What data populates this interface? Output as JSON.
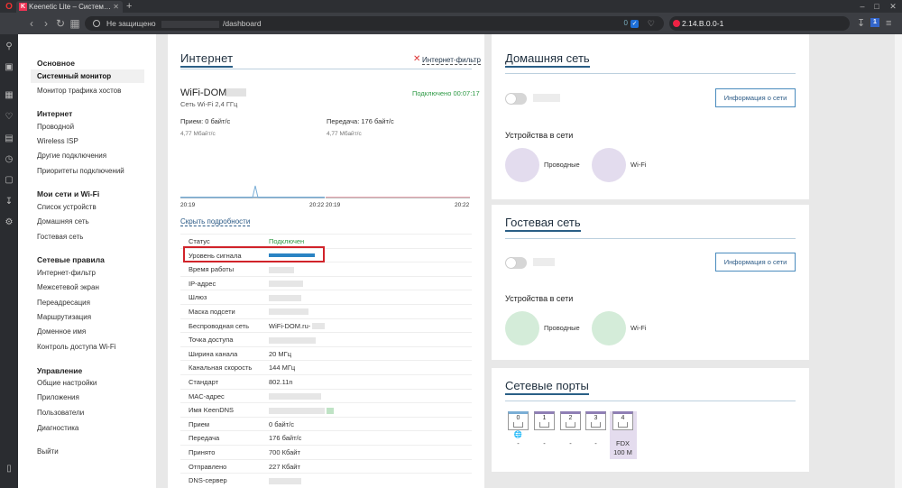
{
  "browser": {
    "tab_title": "Keenetic Lite – Систем…",
    "tab_logo": "K",
    "close_glyph": "✕",
    "new_tab_glyph": "+",
    "security_text": "Не защищено",
    "url_path": "/dashboard",
    "ext_text": "2.14.B.0.0-1",
    "adblock_count": "0"
  },
  "sidebar": {
    "groups": [
      {
        "title": "Основное",
        "items": [
          "Системный монитор",
          "Монитор трафика хостов"
        ]
      },
      {
        "title": "Интернет",
        "items": [
          "Проводной",
          "Wireless ISP",
          "Другие подключения",
          "Приоритеты подключений"
        ]
      },
      {
        "title": "Мои сети и Wi-Fi",
        "items": [
          "Список устройств",
          "Домашняя сеть",
          "Гостевая сеть"
        ]
      },
      {
        "title": "Сетевые правила",
        "items": [
          "Интернет-фильтр",
          "Межсетевой экран",
          "Переадресация",
          "Маршрутизация",
          "Доменное имя",
          "Контроль доступа Wi-Fi"
        ]
      },
      {
        "title": "Управление",
        "items": [
          "Общие настройки",
          "Приложения",
          "Пользователи",
          "Диагностика"
        ]
      }
    ],
    "logout": "Выйти"
  },
  "internet": {
    "title": "Интернет",
    "filter_link": "Интернет-фильтр",
    "wifi_name": "WiFi-DOM.ru-",
    "wifi_sub": "Сеть Wi-Fi 2,4 ГГц",
    "connected": "Подключено 00:07:17",
    "rx_label": "Прием: 0 байт/с",
    "tx_label": "Передача: 176 байт/с",
    "rx_rate": "4,77 Мбайт/с",
    "tx_rate": "4,77 Мбайт/с",
    "time_start": "20:19",
    "time_end": "20:22",
    "hide_details": "Скрыть подробности",
    "rows": [
      {
        "k": "Статус",
        "v": "Подключен",
        "green": true
      },
      {
        "k": "Уровень сигнала",
        "v": ""
      },
      {
        "k": "Время работы",
        "v": ""
      },
      {
        "k": "IP-адрес",
        "v": ""
      },
      {
        "k": "Шлюз",
        "v": ""
      },
      {
        "k": "Маска подсети",
        "v": ""
      },
      {
        "k": "Беспроводная сеть",
        "v": "WiFi-DOM.ru-"
      },
      {
        "k": "Точка доступа",
        "v": ""
      },
      {
        "k": "Ширина канала",
        "v": "20 МГц"
      },
      {
        "k": "Канальная скорость",
        "v": "144 МГц"
      },
      {
        "k": "Стандарт",
        "v": "802.11n"
      },
      {
        "k": "MAC-адрес",
        "v": ""
      },
      {
        "k": "Имя KeenDNS",
        "v": ""
      },
      {
        "k": "Прием",
        "v": "0 байт/с"
      },
      {
        "k": "Передача",
        "v": "176 байт/с"
      },
      {
        "k": "Принято",
        "v": "700 Кбайт"
      },
      {
        "k": "Отправлено",
        "v": "227 Кбайт"
      },
      {
        "k": "DNS-сервер",
        "v": ""
      }
    ],
    "signal_level": 1.0
  },
  "home": {
    "title": "Домашняя сеть",
    "info_button": "Информация о сети",
    "devices_header": "Устройства в сети",
    "wired": "Проводные",
    "wifi": "Wi-Fi"
  },
  "guest": {
    "title": "Гостевая сеть",
    "info_button": "Информация о сети",
    "devices_header": "Устройства в сети",
    "wired": "Проводные",
    "wifi": "Wi-Fi"
  },
  "ports": {
    "title": "Сетевые порты",
    "items": [
      {
        "num": "0",
        "under": "-",
        "globe": true
      },
      {
        "num": "1",
        "under": "-"
      },
      {
        "num": "2",
        "under": "-"
      },
      {
        "num": "3",
        "under": "-"
      },
      {
        "num": "4",
        "under": "FDX",
        "under2": "100 M"
      }
    ]
  },
  "colors": {
    "accent": "#2a5f86",
    "connected": "#2e9a45",
    "highlight_box": "#d1232a",
    "signal_bar": "#2a83c3",
    "port_wan": "#7aaed6",
    "port_lan": "#8f7fb5"
  }
}
